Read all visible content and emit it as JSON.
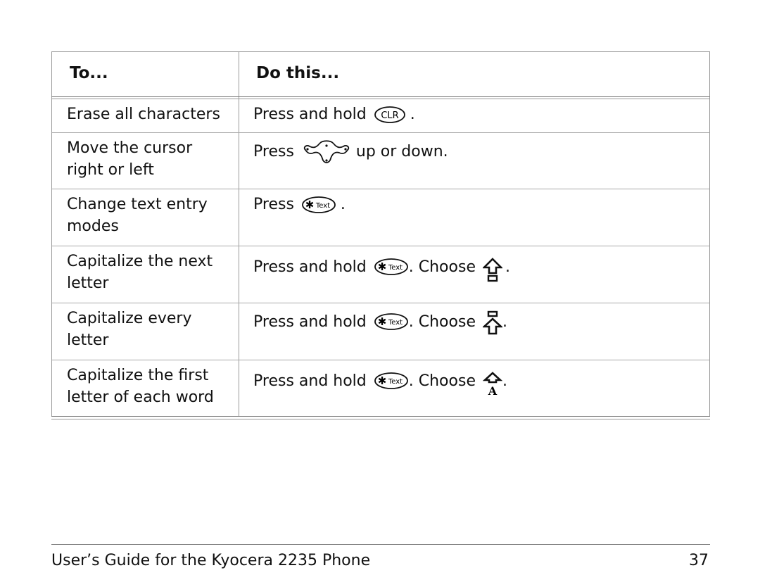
{
  "table": {
    "headers": [
      "To...",
      "Do this..."
    ],
    "rows": [
      {
        "to": "Erase all characters",
        "prefix": "Press and hold",
        "key": "clr-key",
        "suffix": ".",
        "choose": null
      },
      {
        "to": "Move the cursor right or left",
        "prefix": "Press",
        "key": "navigation-key",
        "suffix": "up or down.",
        "choose": null
      },
      {
        "to": "Change text entry modes",
        "prefix": "Press",
        "key": "star-text-key",
        "suffix": ".",
        "choose": null
      },
      {
        "to": "Capitalize the next letter",
        "prefix": "Press and hold",
        "key": "star-text-key",
        "suffix": ". Choose",
        "choose": "next-capital-icon"
      },
      {
        "to": "Capitalize every letter",
        "prefix": "Press and hold",
        "key": "star-text-key",
        "suffix": ". Choose",
        "choose": "caps-lock-icon"
      },
      {
        "to": "Capitalize the first letter of each word",
        "prefix": "Press and hold",
        "key": "star-text-key",
        "suffix": ". Choose",
        "choose": "word-capital-icon"
      }
    ],
    "period": "."
  },
  "keys": {
    "clr_label": "CLR",
    "text_label": "Text",
    "word_cap_letter": "A"
  },
  "footer": {
    "title": "User’s Guide for the Kyocera 2235 Phone",
    "page": "37"
  }
}
